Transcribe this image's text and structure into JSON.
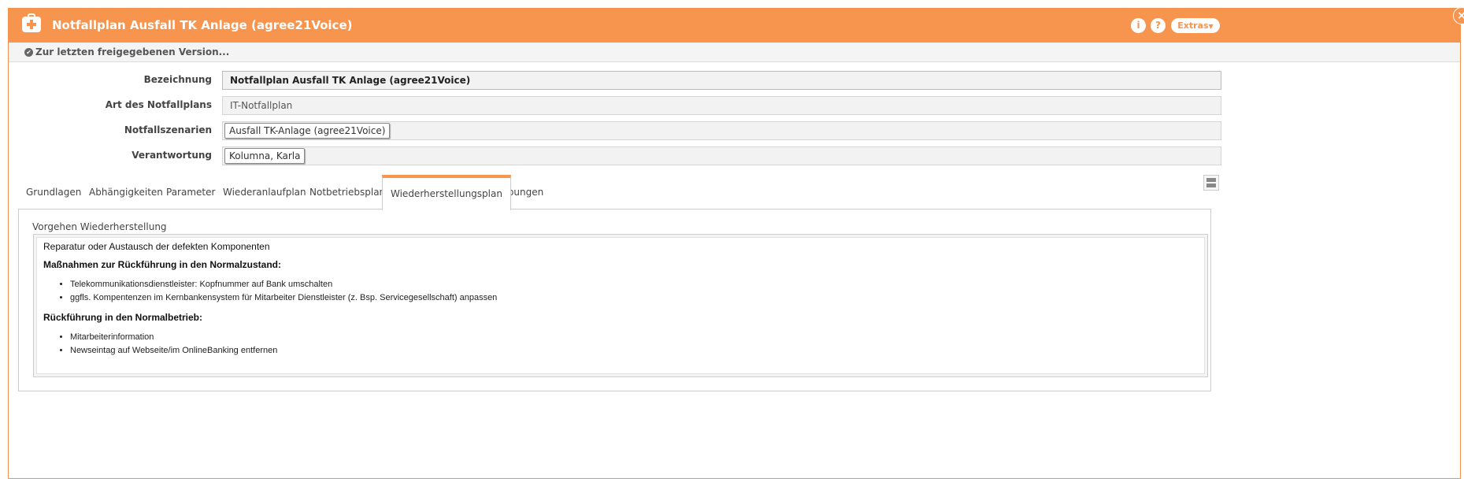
{
  "window": {
    "title": "Notfallplan Ausfall TK Anlage (agree21Voice)",
    "info_icon": "i",
    "help_icon": "?",
    "extras_label": "Extras",
    "close_icon": "×"
  },
  "subbar": {
    "link_text": "Zur letzten freigegebenen Version..."
  },
  "form": {
    "bezeichnung": {
      "label": "Bezeichnung",
      "value": "Notfallplan Ausfall TK Anlage (agree21Voice)"
    },
    "art": {
      "label": "Art des Notfallplans",
      "value": "IT-Notfallplan"
    },
    "szenarien": {
      "label": "Notfallszenarien",
      "tag": "Ausfall TK-Anlage (agree21Voice)"
    },
    "verantwortung": {
      "label": "Verantwortung",
      "tag": "Kolumna, Karla"
    }
  },
  "tabs": [
    {
      "label": "Grundlagen"
    },
    {
      "label": "Abhängigkeiten"
    },
    {
      "label": "Parameter"
    },
    {
      "label": "Wiederanlaufplan"
    },
    {
      "label": "Notbetriebsplan"
    },
    {
      "label": "Wiederherstellungsplan",
      "active": true
    },
    {
      "label": "Übungen"
    }
  ],
  "panel": {
    "section_label": "Vorgehen Wiederherstellung",
    "content": {
      "intro": "Reparatur oder Austausch der defekten Komponenten",
      "heading1": "Maßnahmen zur Rückführung in den Normalzustand:",
      "list1": [
        "Telekommunikationsdienstleister: Kopfnummer auf Bank umschalten",
        "ggfls. Kompentenzen im Kernbankensystem für Mitarbeiter Dienstleister (z. Bsp. Servicegesellschaft)  anpassen"
      ],
      "heading2": "Rückführung in den Normalbetrieb:",
      "list2": [
        "Mitarbeiterinformation",
        "Newseintag auf Webseite/im OnlineBanking entfernen"
      ]
    }
  },
  "colors": {
    "accent": "#f7954f",
    "field_bg": "#f2f2f2",
    "border": "#cccccc"
  }
}
